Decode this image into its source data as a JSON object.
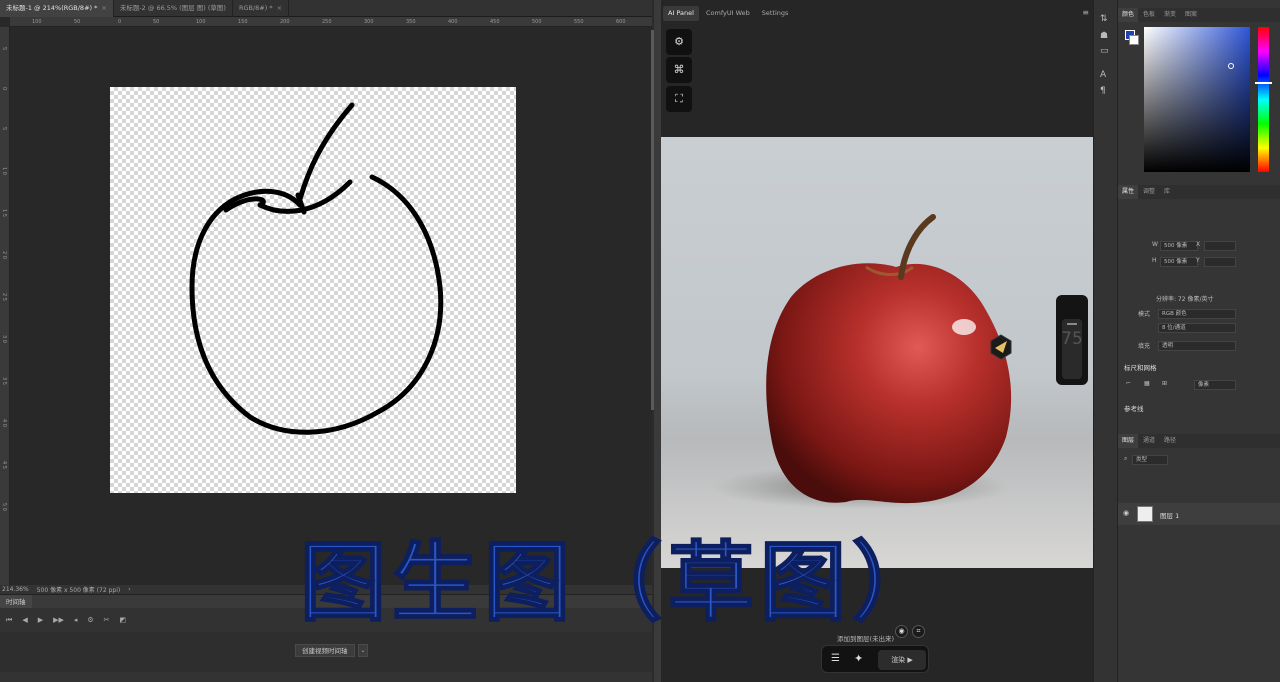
{
  "doc_tabs": [
    {
      "label": "未标题-1 @ 214%(RGB/8#) *",
      "active": true
    },
    {
      "label": "未标题-2 @ 66.5% (图层 图) (草图)",
      "active": false
    },
    {
      "label": "RGB/8#) *",
      "active": false
    }
  ],
  "ruler_top": [
    "100",
    "50",
    "0",
    "50",
    "100",
    "150",
    "200",
    "250",
    "300",
    "350",
    "400",
    "450",
    "500",
    "550",
    "600"
  ],
  "ruler_left": [
    "5",
    "0",
    "5",
    "1 0",
    "1 5",
    "2 0",
    "2 5",
    "3 0",
    "3 5",
    "4 0",
    "4 5",
    "5 0"
  ],
  "status": {
    "zoom": "214.36%",
    "size": "500 像素 x 500 像素 (72 ppi)",
    "arrow": "›"
  },
  "timeline": {
    "tab": "时间轴",
    "create_button": "创建视频时间轴",
    "dropdown_icon": "chevron-down-icon"
  },
  "ai_panel": {
    "tabs": [
      "AI Panel",
      "ComfyUI Web",
      "Settings"
    ],
    "strength_value": "75",
    "add_layer_text": "添加到图层(未出来)",
    "render_label": "渲染 ▶"
  },
  "panels": {
    "color_tabs": [
      "颜色",
      "色板",
      "渐变",
      "图案"
    ],
    "props_tabs": [
      "属性",
      "调整",
      "库"
    ],
    "w_label": "W",
    "w_value": "500 像素",
    "h_label": "H",
    "h_value": "500 像素",
    "x_label": "X",
    "y_label": "Y",
    "resolution": "分辨率: 72 像素/英寸",
    "mode_label": "模式",
    "mode_value": "RGB 颜色",
    "bit_value": "8 位/通道",
    "fill_label": "填充",
    "fill_value": "透明",
    "ruler_grid_title": "标尺和网格",
    "ruler_unit": "像素",
    "guides_title": "参考线",
    "layers_tabs": [
      "图层",
      "通道",
      "路径"
    ],
    "layer_filter": "类型",
    "layer_name": "图层 1"
  },
  "caption": "图生图（草图）",
  "colors": {
    "caption_blue": "#2a56c6",
    "fg_swatch": "#2244aa"
  }
}
